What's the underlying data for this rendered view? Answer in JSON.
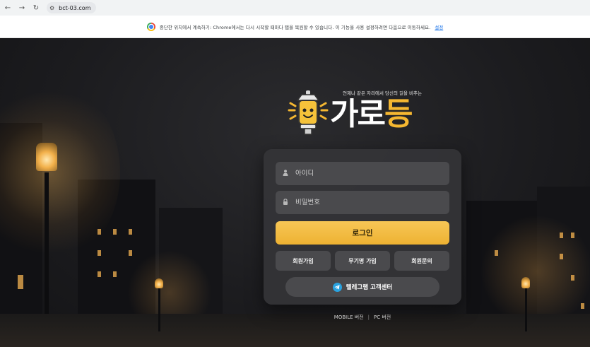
{
  "browser": {
    "url": "bct-03.com",
    "infobar_message": "중단한 위치에서 계속하기: Chrome에서는 다시 시작할 때마다 탭을 복원할 수 있습니다. 이 기능을 사용 설정하려면 다음으로 이동하세요.",
    "infobar_link": "설정"
  },
  "brand": {
    "tagline": "언제나 같은 자리에서 당신의 길을 비추는",
    "name_white": "가로",
    "name_yellow": "등",
    "accent_color": "#f5b731"
  },
  "login": {
    "id_placeholder": "아이디",
    "pw_placeholder": "비밀번호",
    "login_label": "로그인",
    "signup_label": "회원가입",
    "anon_signup_label": "무기명 가입",
    "inquiry_label": "회원문의",
    "telegram_label": "텔레그램 고객센터"
  },
  "footer": {
    "mobile_label": "MOBILE 버전",
    "separator": "|",
    "pc_label": "PC 버전"
  }
}
